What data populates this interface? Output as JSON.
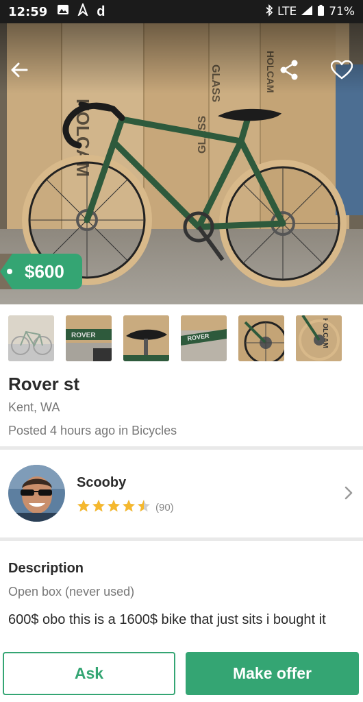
{
  "status_bar": {
    "time": "12:59",
    "network": "LTE",
    "battery": "71%"
  },
  "listing": {
    "price": "$600",
    "title": "Rover st",
    "location": "Kent, WA",
    "posted": "Posted 4 hours ago in Bicycles",
    "thumbnail_count": 6
  },
  "seller": {
    "name": "Scooby",
    "rating": 4.5,
    "reviews": "(90)"
  },
  "description": {
    "heading": "Description",
    "condition": "Open box (never used)",
    "text": "600$ obo this is a 1600$ bike that just sits i bought it"
  },
  "actions": {
    "ask": "Ask",
    "make_offer": "Make offer"
  },
  "colors": {
    "accent": "#34a573",
    "star": "#f5b82e",
    "bike_frame": "#2e5a3c"
  },
  "icons": [
    "back-arrow-icon",
    "share-icon",
    "heart-icon",
    "star-icon",
    "chevron-right-icon"
  ]
}
